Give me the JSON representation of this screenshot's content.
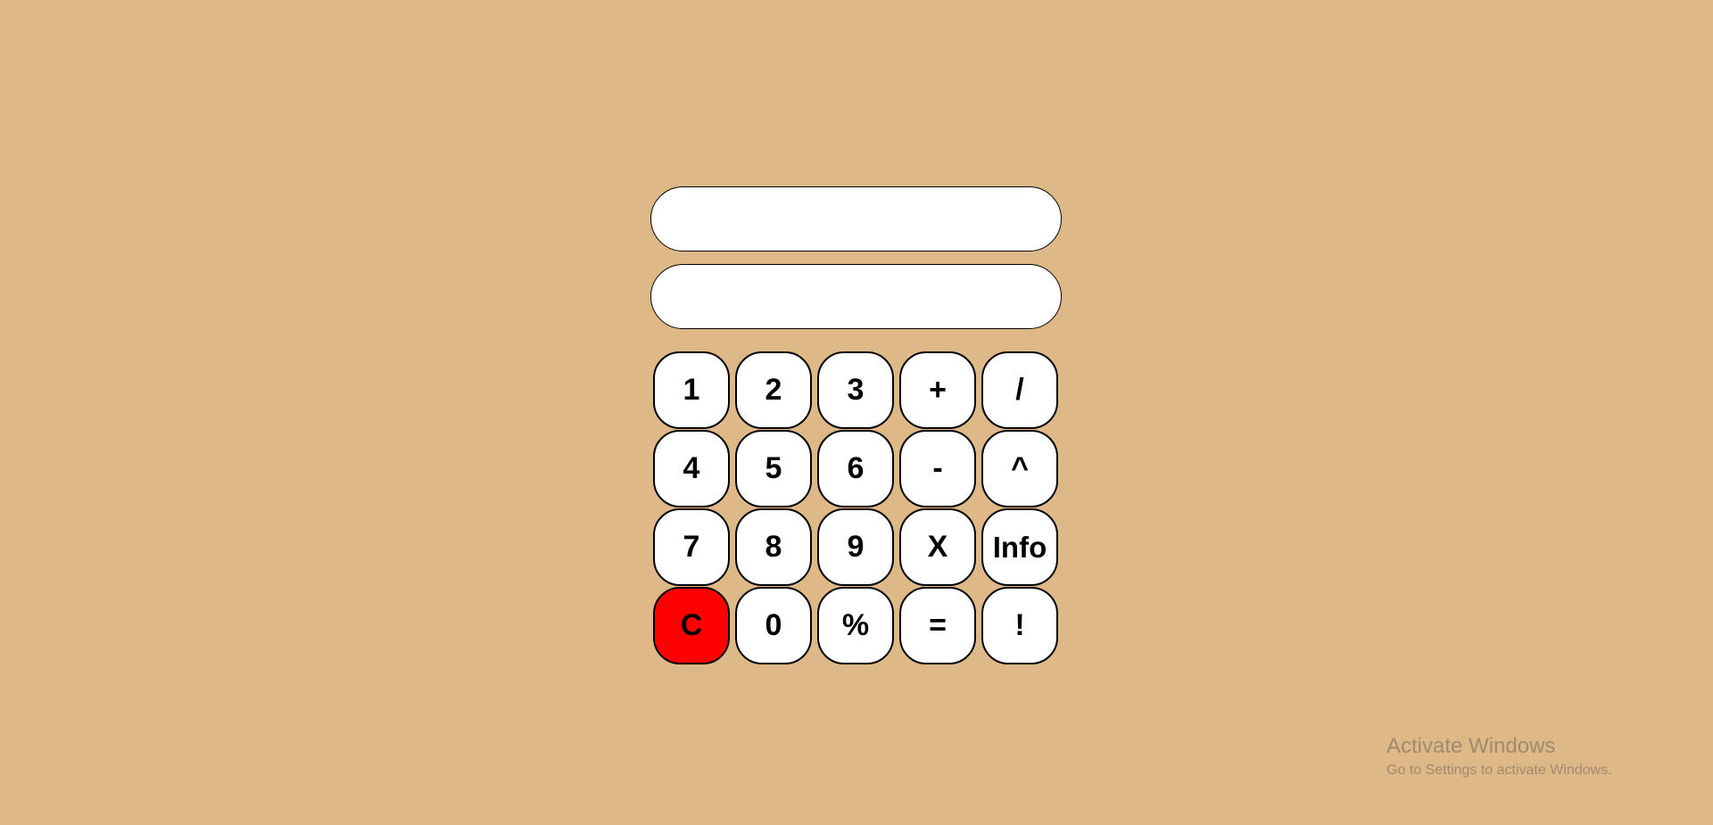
{
  "display": {
    "expression": "",
    "result": ""
  },
  "keypad": {
    "rows": [
      [
        {
          "label": "1",
          "name": "key-1"
        },
        {
          "label": "2",
          "name": "key-2"
        },
        {
          "label": "3",
          "name": "key-3"
        },
        {
          "label": "+",
          "name": "key-plus"
        },
        {
          "label": "/",
          "name": "key-divide"
        }
      ],
      [
        {
          "label": "4",
          "name": "key-4"
        },
        {
          "label": "5",
          "name": "key-5"
        },
        {
          "label": "6",
          "name": "key-6"
        },
        {
          "label": "-",
          "name": "key-minus"
        },
        {
          "label": "^",
          "name": "key-power"
        }
      ],
      [
        {
          "label": "7",
          "name": "key-7"
        },
        {
          "label": "8",
          "name": "key-8"
        },
        {
          "label": "9",
          "name": "key-9"
        },
        {
          "label": "X",
          "name": "key-multiply"
        },
        {
          "label": "Info",
          "name": "key-info"
        }
      ],
      [
        {
          "label": "C",
          "name": "key-clear"
        },
        {
          "label": "0",
          "name": "key-0"
        },
        {
          "label": "%",
          "name": "key-percent"
        },
        {
          "label": "=",
          "name": "key-equals"
        },
        {
          "label": "!",
          "name": "key-factorial"
        }
      ]
    ]
  },
  "colors": {
    "background": "#deb887",
    "clear_key": "#ff0000",
    "key_face": "#ffffff"
  },
  "watermark": {
    "title": "Activate Windows",
    "subtitle": "Go to Settings to activate Windows."
  }
}
